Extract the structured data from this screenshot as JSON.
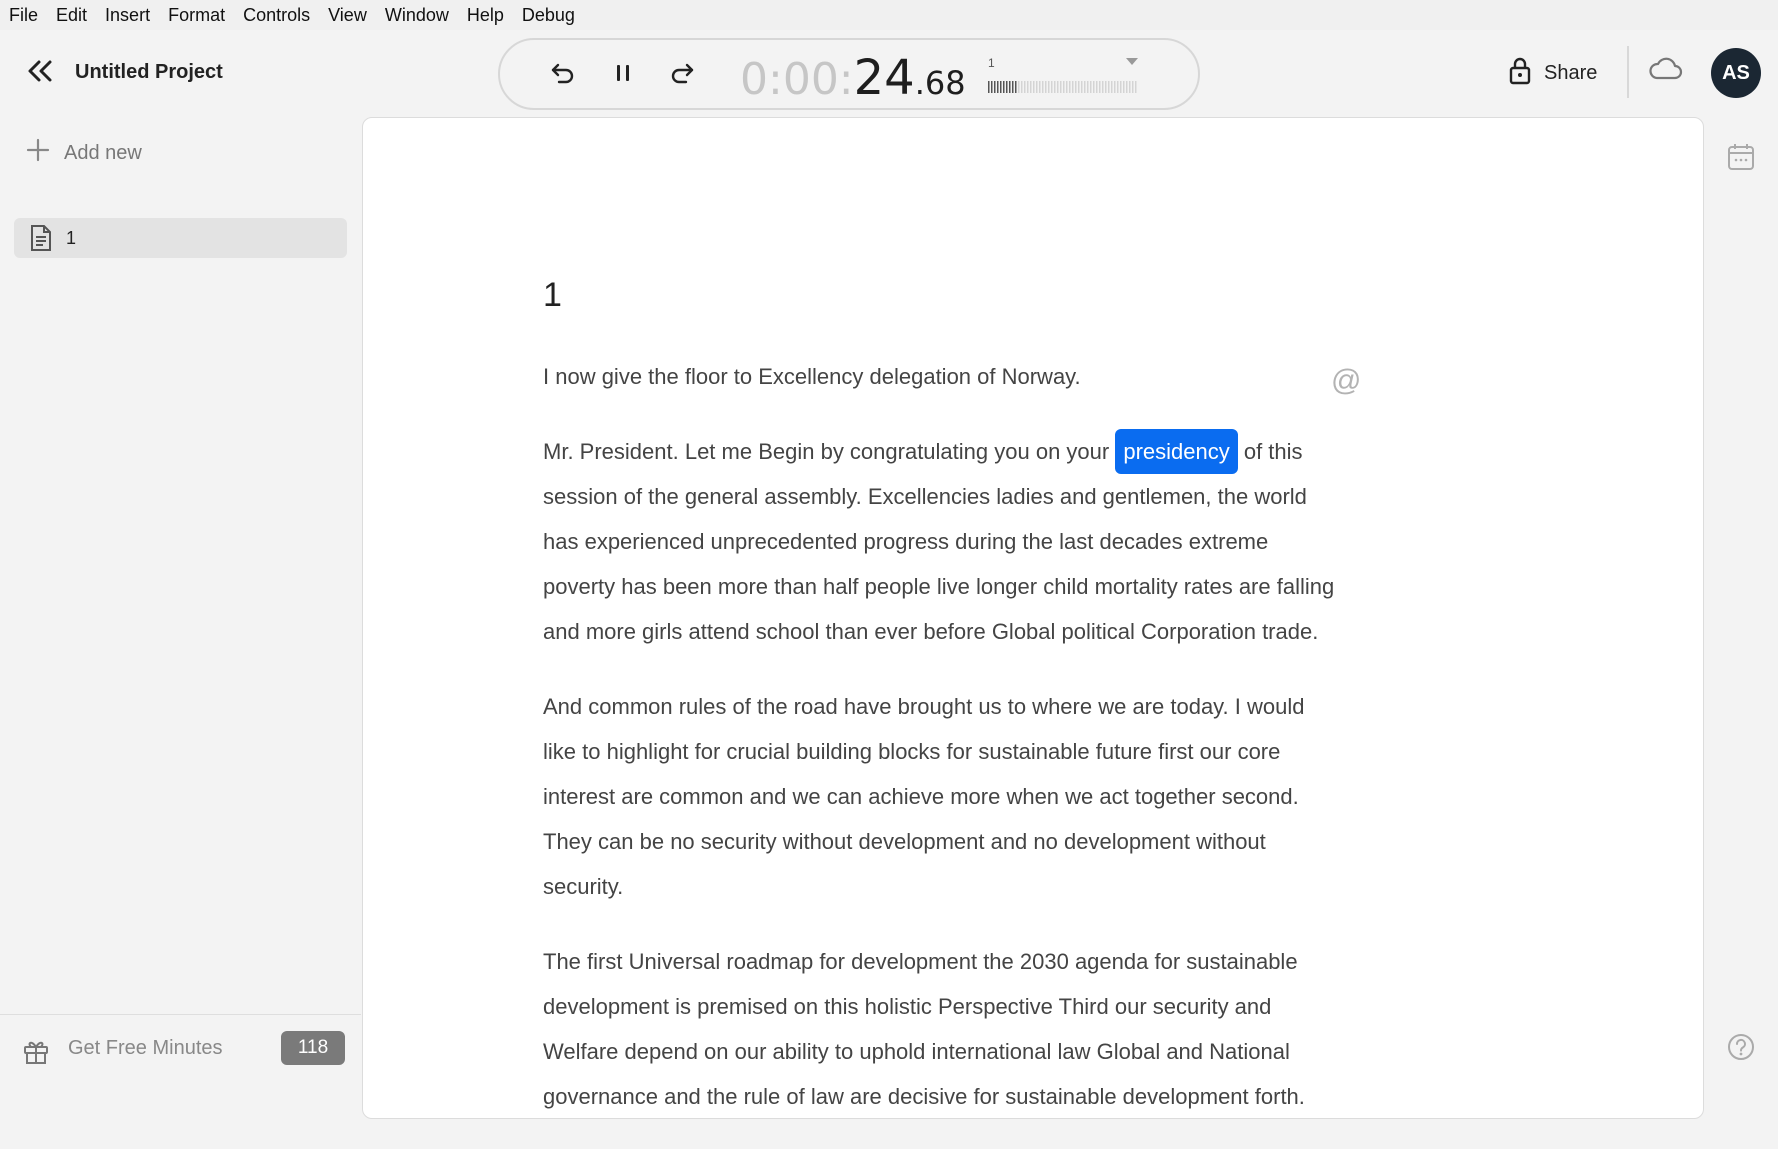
{
  "menu": [
    "File",
    "Edit",
    "Insert",
    "Format",
    "Controls",
    "View",
    "Window",
    "Help",
    "Debug"
  ],
  "project": {
    "title": "Untitled Project"
  },
  "player": {
    "time_dim": "0:00:",
    "time_main": "24",
    "time_frac": ".68",
    "speed_label": "1"
  },
  "share": {
    "label": "Share"
  },
  "user": {
    "initials": "AS"
  },
  "sidebar": {
    "add_new_label": "Add new",
    "documents": [
      {
        "name": "1"
      }
    ],
    "footer": {
      "label": "Get Free Minutes",
      "minutes": "118"
    }
  },
  "document": {
    "title": "1",
    "paragraphs": [
      "I now give the floor to Excellency delegation of Norway.",
      {
        "before": "Mr. President. Let me Begin by congratulating you on your ",
        "highlight": "presidency",
        "after": " of this session of the general assembly. Excellencies ladies and gentlemen, the world has experienced unprecedented progress during the last decades extreme poverty has been more than half people live longer child mortality rates are falling and more girls attend school than ever before Global political Corporation trade."
      },
      "And common rules of the road have brought us to where we are today. I would like to highlight for crucial building blocks for sustainable future first our core interest are common and we can achieve more when we act together second. They can be no security without development and no development without security.",
      "The first Universal roadmap for development the 2030 agenda for sustainable development is premised on this holistic Perspective Third our security and Welfare depend on our ability to uphold international law Global and National governance and the rule of law are decisive for sustainable development forth."
    ]
  },
  "colors": {
    "highlight": "#0a6cf0",
    "avatar_bg": "#1b2733",
    "badge_bg": "#7a7a7a"
  },
  "icons": [
    "double-chevron-left-icon",
    "undo-icon",
    "pause-icon",
    "redo-icon",
    "lock-icon",
    "cloud-icon",
    "plus-icon",
    "document-icon",
    "gift-icon",
    "at-icon",
    "calendar-icon",
    "help-icon"
  ]
}
